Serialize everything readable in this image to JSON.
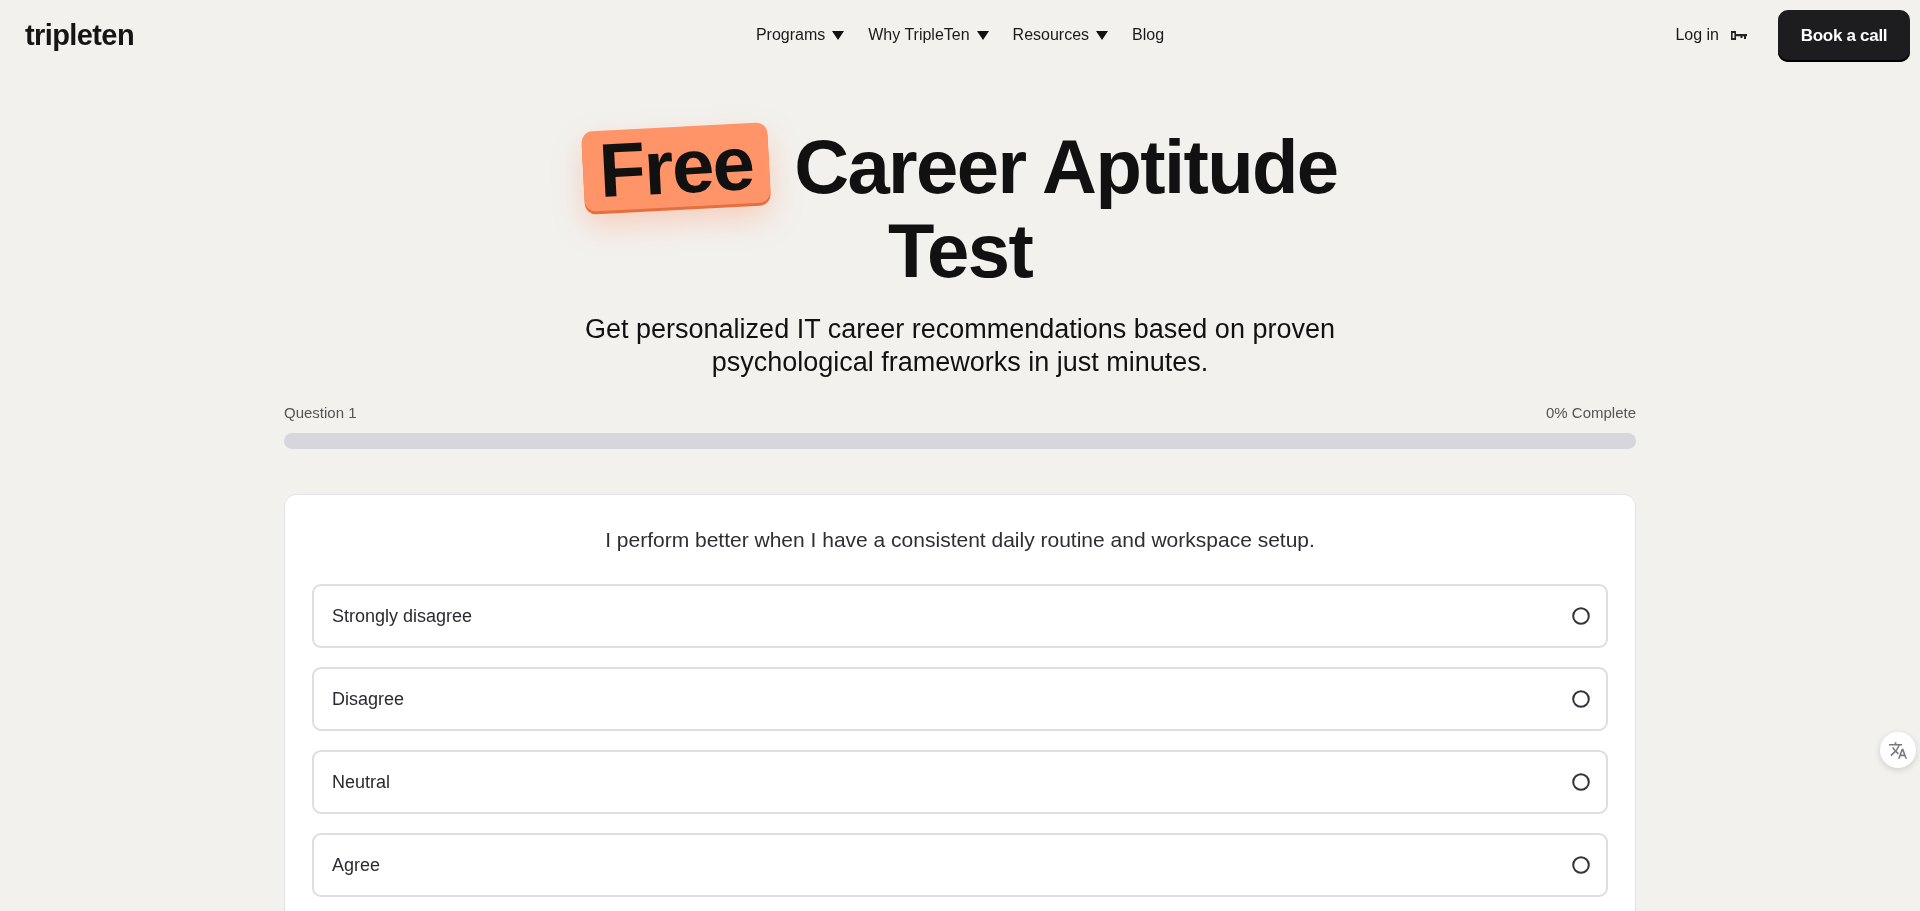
{
  "header": {
    "logo": "tripleten",
    "nav": [
      {
        "label": "Programs",
        "has_menu": true
      },
      {
        "label": "Why TripleTen",
        "has_menu": true
      },
      {
        "label": "Resources",
        "has_menu": true
      },
      {
        "label": "Blog",
        "has_menu": false
      }
    ],
    "login": "Log in",
    "cta": "Book a call"
  },
  "hero": {
    "badge": "Free",
    "title": "Career Aptitude Test",
    "subtitle": "Get personalized IT career recommendations based on proven psychological frameworks in just minutes."
  },
  "progress": {
    "question": "Question 1",
    "complete": "0% Complete",
    "level": 0
  },
  "quiz": {
    "question": "I perform better when I have a consistent daily routine and workspace setup.",
    "options": [
      {
        "label": "Strongly disagree",
        "selected": false
      },
      {
        "label": "Disagree",
        "selected": false
      },
      {
        "label": "Neutral",
        "selected": false
      },
      {
        "label": "Agree",
        "selected": false
      }
    ]
  }
}
